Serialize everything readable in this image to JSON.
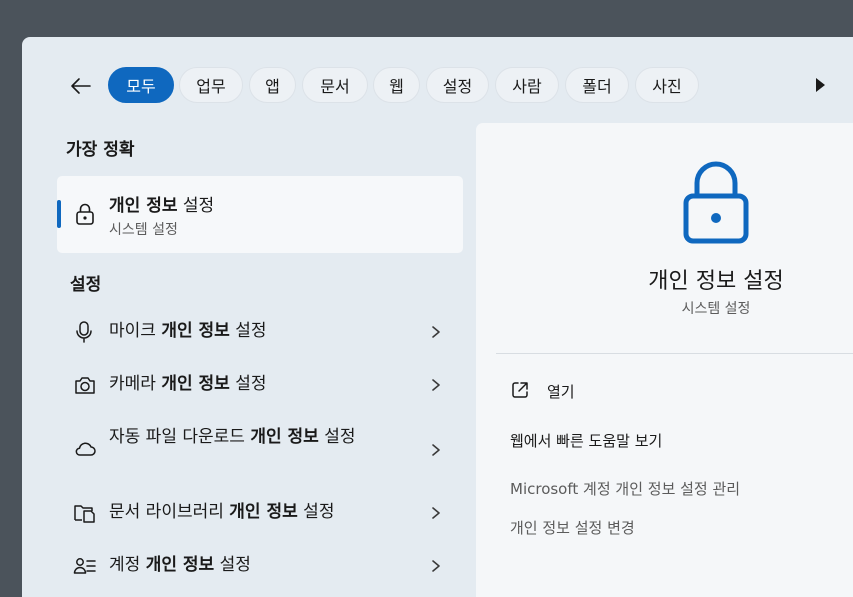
{
  "filters": {
    "back_label": "Back",
    "chips": [
      {
        "label": "모두",
        "active": true
      },
      {
        "label": "업무",
        "active": false
      },
      {
        "label": "앱",
        "active": false
      },
      {
        "label": "문서",
        "active": false
      },
      {
        "label": "웹",
        "active": false
      },
      {
        "label": "설정",
        "active": false
      },
      {
        "label": "사람",
        "active": false
      },
      {
        "label": "폴더",
        "active": false
      },
      {
        "label": "사진",
        "active": false
      }
    ],
    "more_icon": "play-icon"
  },
  "best_match": {
    "heading": "가장 정확",
    "title_bold": "개인 정보",
    "title_rest": " 설정",
    "subtitle": "시스템 설정",
    "icon": "lock-icon"
  },
  "settings": {
    "heading": "설정",
    "items": [
      {
        "icon": "microphone-icon",
        "pre": "마이크 ",
        "bold": "개인 정보",
        "post": " 설정"
      },
      {
        "icon": "camera-icon",
        "pre": "카메라 ",
        "bold": "개인 정보",
        "post": " 설정"
      },
      {
        "icon": "cloud-icon",
        "pre": "자동 파일 다운로드 ",
        "bold": "개인 정보",
        "post": " 설정"
      },
      {
        "icon": "document-folder-icon",
        "pre": "문서 라이브러리 ",
        "bold": "개인 정보",
        "post": " 설정"
      },
      {
        "icon": "account-settings-icon",
        "pre": "계정 ",
        "bold": "개인 정보",
        "post": " 설정"
      }
    ]
  },
  "detail": {
    "title": "개인 정보 설정",
    "subtitle": "시스템 설정",
    "open_label": "열기",
    "web_help": "웹에서 빠른 도움말 보기",
    "links": [
      "Microsoft 계정 개인 정보 설정 관리",
      "개인 정보 설정 변경"
    ]
  },
  "colors": {
    "accent": "#0f68bf",
    "panel": "#e4ebf1",
    "pane": "#f5f7f9"
  }
}
